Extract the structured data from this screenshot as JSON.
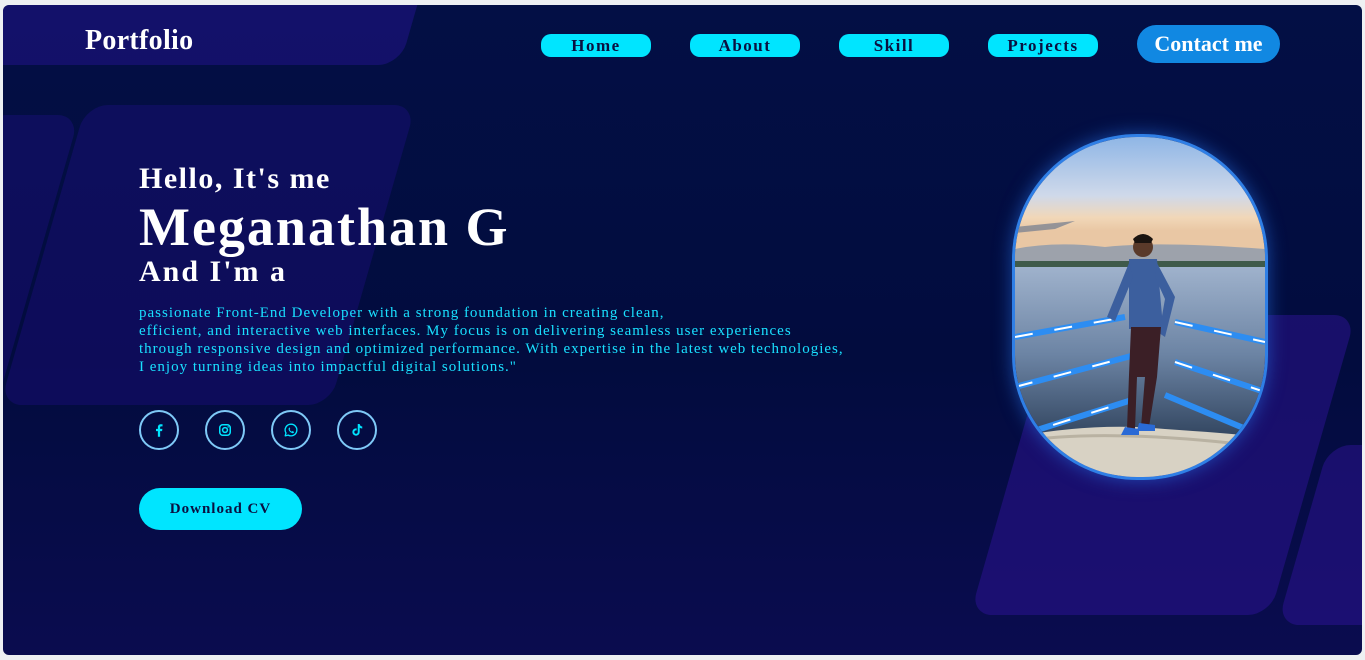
{
  "nav": {
    "logo": "Portfolio",
    "links": [
      "Home",
      "About",
      "Skill",
      "Projects"
    ],
    "contact": "Contact me"
  },
  "hero": {
    "greeting": "Hello, It's me",
    "name": "Meganathan G",
    "role_intro": "And I'm a",
    "bio_lines": [
      "passionate Front-End Developer with a strong foundation in creating clean,",
      "efficient, and interactive web interfaces. My focus is on delivering seamless user experiences",
      "through responsive design and optimized performance. With expertise in the latest web technologies,",
      "I enjoy turning ideas into impactful digital solutions.\""
    ],
    "cv_button": "Download CV"
  },
  "socials": [
    "facebook-icon",
    "instagram-icon",
    "whatsapp-icon",
    "tiktok-icon"
  ],
  "colors": {
    "background": "#030f45",
    "accent_cyan": "#00e5ff",
    "contact_blue": "#1188e2",
    "bio_text": "#19e0ff",
    "photo_border": "#2f7fe6"
  }
}
